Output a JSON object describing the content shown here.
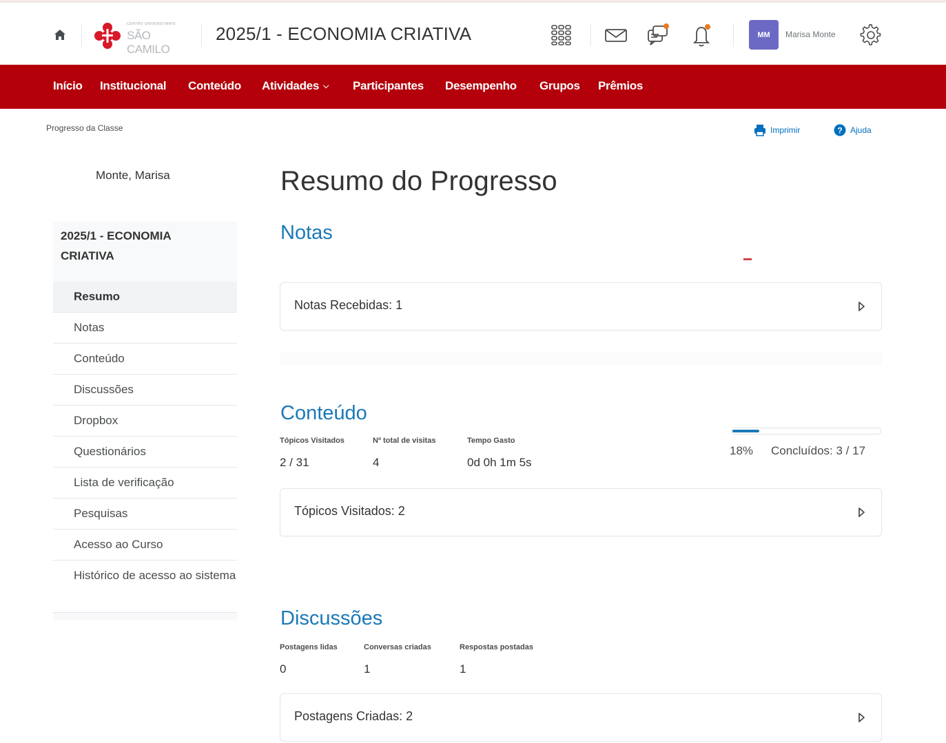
{
  "header": {
    "logo_small": "CENTRO UNIVERSITARIO",
    "logo_text": "SÃO CAMILO",
    "course_title": "2025/1 - ECONOMIA CRIATIVA",
    "avatar_initials": "MM",
    "user_name": "Marisa Monte",
    "icons": [
      "home-icon",
      "apps-grid-icon",
      "mail-icon",
      "chat-icon",
      "bell-icon",
      "gear-icon"
    ],
    "accent_color": "#b3000b",
    "notification_dot_color": "#e87a22"
  },
  "nav": {
    "items": [
      "Início",
      "Institucional",
      "Conteúdo",
      "Atividades",
      "Participantes",
      "Desempenho",
      "Grupos",
      "Prêmios"
    ]
  },
  "breadcrumb": "Progresso da Classe",
  "tools": {
    "print_label": "Imprimir",
    "help_label": "Ajuda"
  },
  "sidebar": {
    "student_name": "Monte, Marisa",
    "course_title": "2025/1 - ECONOMIA CRIATIVA",
    "items": [
      "Resumo",
      "Notas",
      "Conteúdo",
      "Discussões",
      "Dropbox",
      "Questionários",
      "Lista de verificação",
      "Pesquisas",
      "Acesso ao Curso",
      "Histórico de acesso ao sistema"
    ],
    "active_item": "Resumo"
  },
  "main": {
    "title": "Resumo do Progresso",
    "notas": {
      "heading": "Notas",
      "expand_label": "Notas Recebidas: 1"
    },
    "conteudo": {
      "heading": "Conteúdo",
      "stats": [
        {
          "label": "Tópicos Visitados",
          "value": "2 / 31"
        },
        {
          "label": "Nº total de visitas",
          "value": "4"
        },
        {
          "label": "Tempo Gasto",
          "value": "0d 0h 1m 5s"
        }
      ],
      "progress_fraction": 0.18,
      "progress_percent": "18%",
      "completed_label": "Concluídos: 3 / 17",
      "expand_label": "Tópicos Visitados: 2"
    },
    "discussoes": {
      "heading": "Discussões",
      "stats": [
        {
          "label": "Postagens lidas",
          "value": "0"
        },
        {
          "label": "Conversas criadas",
          "value": "1"
        },
        {
          "label": "Respostas postadas",
          "value": "1"
        }
      ],
      "expand_label": "Postagens Criadas: 2"
    }
  }
}
